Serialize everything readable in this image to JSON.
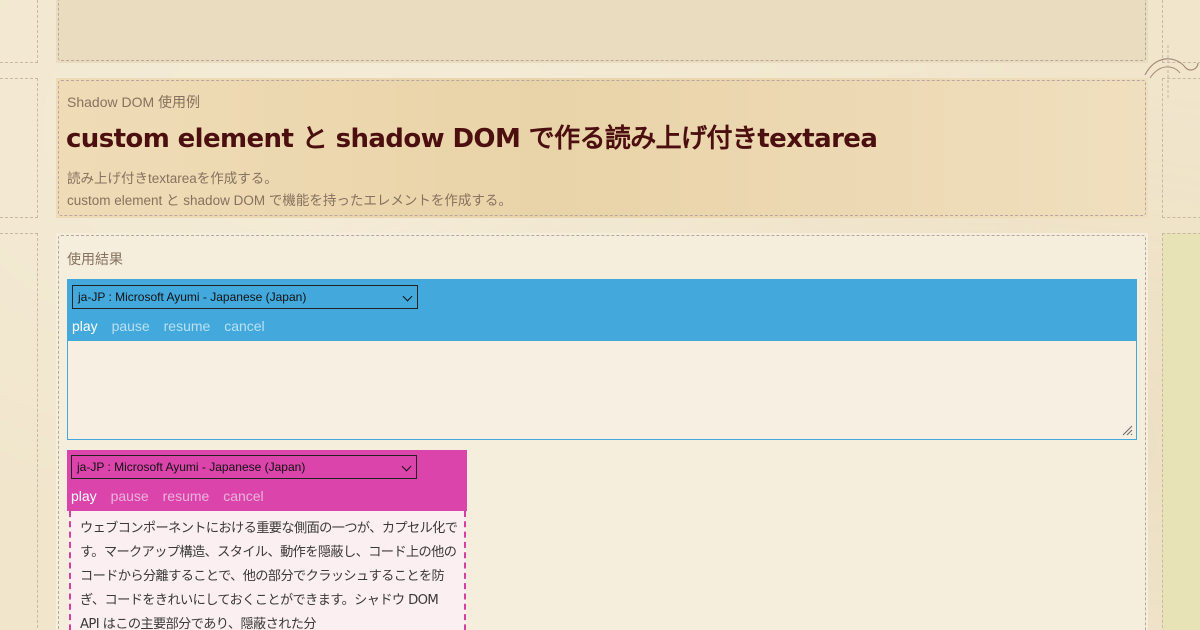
{
  "header": {
    "eyebrow": "Shadow DOM 使用例",
    "title": "custom element と shadow DOM で作る読み上げ付きtextarea",
    "description_lines": [
      "読み上げ付きtextareaを作成する。",
      "custom element と shadow DOM で機能を持ったエレメントを作成する。"
    ]
  },
  "main": {
    "section_label": "使用結果",
    "widgets": [
      {
        "voice": "ja-JP : Microsoft Ayumi - Japanese (Japan)",
        "controls": [
          "play",
          "pause",
          "resume",
          "cancel"
        ],
        "textarea_value": "",
        "color": "#43a9dd"
      },
      {
        "voice": "ja-JP : Microsoft Ayumi - Japanese (Japan)",
        "controls": [
          "play",
          "pause",
          "resume",
          "cancel"
        ],
        "text": "ウェブコンポーネントにおける重要な側面の一つが、カプセル化です。マークアップ構造、スタイル、動作を隠蔽し、コード上の他のコードから分離することで、他の部分でクラッシュすることを防ぎ、コードをきれいにしておくことができます。シャドウ DOM API はこの主要部分であり、隠蔽された分",
        "color": "#db44ab"
      }
    ]
  },
  "colors": {
    "title": "#4b0f0f",
    "muted_text": "#86725e",
    "blue_accent": "#43a9dd",
    "pink_accent": "#db44ab"
  }
}
